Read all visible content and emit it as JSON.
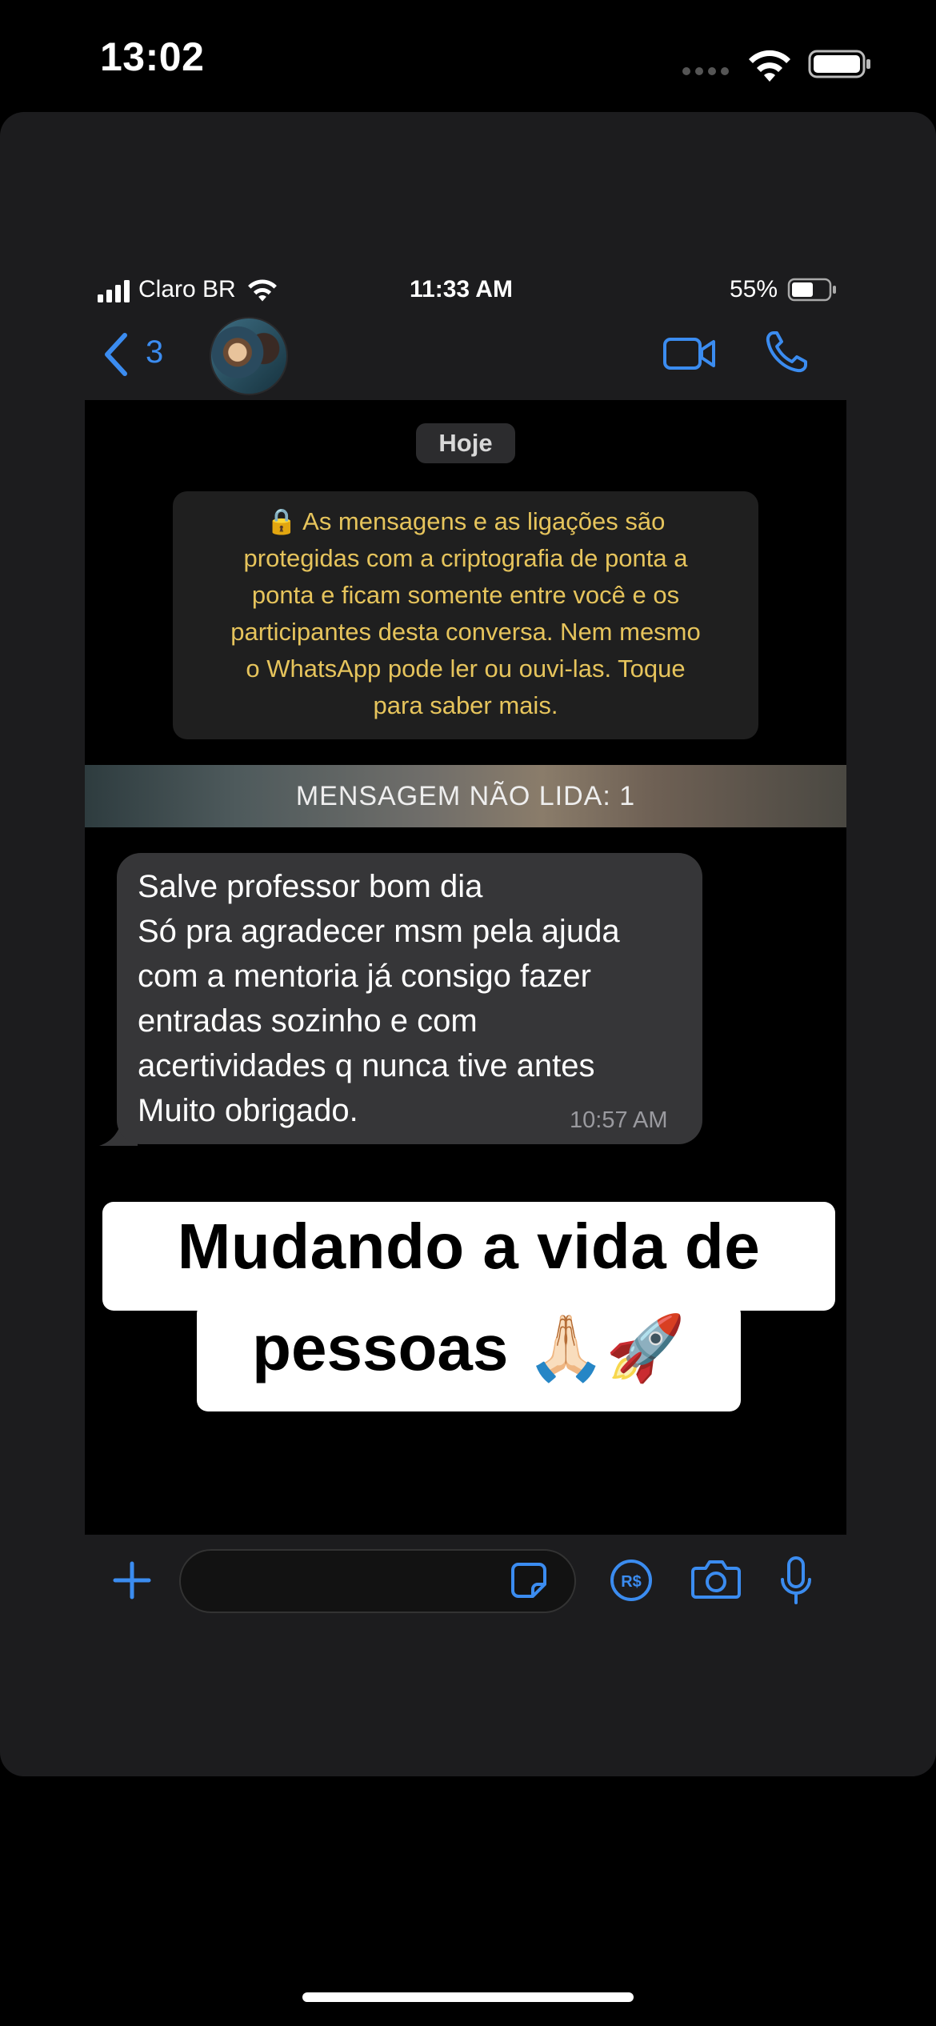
{
  "outer_status": {
    "time": "13:02"
  },
  "inner_status": {
    "carrier": "Claro BR",
    "time": "11:33 AM",
    "battery": "55%"
  },
  "header": {
    "back_count": "3",
    "icons": [
      "back-chevron-icon",
      "video-call-icon",
      "phone-icon"
    ]
  },
  "chat": {
    "date": "Hoje",
    "encryption_lines": [
      "🔒 As mensagens e as ligações são",
      "protegidas com a criptografia de ponta a",
      "ponta e ficam somente entre você e os",
      "participantes desta conversa. Nem mesmo",
      "o WhatsApp pode ler ou ouvi-las. Toque",
      "para saber mais."
    ],
    "unread_banner": "MENSAGEM NÃO LIDA: 1",
    "message": {
      "lines": [
        "Salve professor bom dia",
        "Só pra agradecer msm pela ajuda",
        "com a mentoria já consigo fazer",
        "entradas sozinho e com",
        "acertividades q nunca tive antes",
        "Muito obrigado."
      ],
      "time": "10:57 AM"
    }
  },
  "caption": {
    "line1": "Mudando a vida de",
    "line2": "pessoas 🙏🏻🚀"
  },
  "input_bar": {
    "icons": [
      "plus-icon",
      "sticker-icon",
      "payment-icon",
      "camera-icon",
      "microphone-icon"
    ]
  },
  "colors": {
    "accent": "#3b8cf0",
    "encryption_text": "#e6c45c",
    "bubble": "#363638"
  }
}
